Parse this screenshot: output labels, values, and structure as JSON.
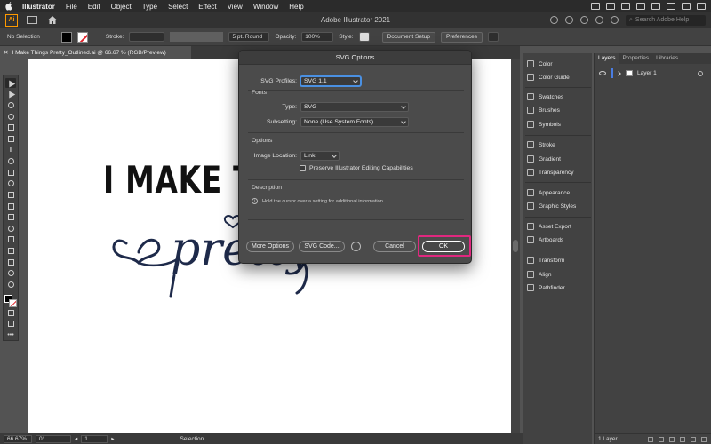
{
  "menubar": {
    "items": [
      "Illustrator",
      "File",
      "Edit",
      "Object",
      "Type",
      "Select",
      "Effect",
      "View",
      "Window",
      "Help"
    ]
  },
  "appbar": {
    "logo": "Ai",
    "title": "Adobe Illustrator 2021",
    "search_placeholder": "Search Adobe Help"
  },
  "controlbar": {
    "selection": "No Selection",
    "stroke_label": "Stroke:",
    "brush": "5 pt. Round",
    "opacity_label": "Opacity:",
    "opacity_value": "100%",
    "style_label": "Style:",
    "doc_setup": "Document Setup",
    "preferences": "Preferences"
  },
  "doc": {
    "tab_title": "I Make Things Pretty_Outlined.ai @ 66.67 % (RGB/Preview)",
    "art_heading": "I MAKE T",
    "art_script": "pretty"
  },
  "dialog": {
    "title": "SVG Options",
    "svg_profiles_label": "SVG Profiles:",
    "svg_profiles_value": "SVG 1.1",
    "fonts_heading": "Fonts",
    "type_label": "Type:",
    "type_value": "SVG",
    "subsetting_label": "Subsetting:",
    "subsetting_value": "None (Use System Fonts)",
    "options_heading": "Options",
    "image_location_label": "Image Location:",
    "image_location_value": "Link",
    "preserve_label": "Preserve Illustrator Editing Capabilities",
    "description_heading": "Description",
    "description_text": "Hold the cursor over a setting for additional information.",
    "more_options": "More Options",
    "svg_code": "SVG Code...",
    "cancel": "Cancel",
    "ok": "OK"
  },
  "panels": {
    "groups": [
      [
        "Color",
        "Color Guide"
      ],
      [
        "Swatches",
        "Brushes",
        "Symbols"
      ],
      [
        "Stroke",
        "Gradient",
        "Transparency"
      ],
      [
        "Appearance",
        "Graphic Styles"
      ],
      [
        "Asset Export",
        "Artboards"
      ],
      [
        "Transform",
        "Align",
        "Pathfinder"
      ]
    ]
  },
  "layers": {
    "tabs": [
      "Layers",
      "Properties",
      "Libraries"
    ],
    "layer_name": "Layer 1",
    "footer": "1 Layer"
  },
  "statusbar": {
    "zoom": "66.67%",
    "rotation": "0°",
    "artboard": "1",
    "tool": "Selection"
  },
  "colors": {
    "highlight": "#e0287f",
    "accent_blue": "#4a7de2",
    "illustrator_orange": "#ff9a00",
    "script_navy": "#1e2a4a"
  }
}
